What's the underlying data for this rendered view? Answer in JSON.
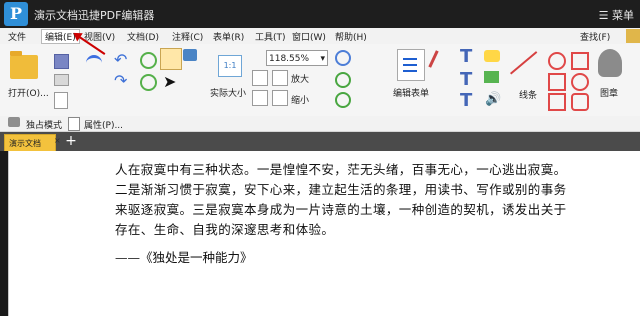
{
  "window": {
    "title": "演示文档迅捷PDF编辑器",
    "logo": "P",
    "menu_button": "☰ 菜单"
  },
  "menubar": {
    "items": [
      {
        "label": "文件"
      },
      {
        "label": "编辑(E)"
      },
      {
        "label": "视图(V)"
      },
      {
        "label": "文档(D)"
      },
      {
        "label": "注释(C)"
      },
      {
        "label": "表单(R)"
      },
      {
        "label": "工具(T)"
      },
      {
        "label": "窗口(W)"
      },
      {
        "label": "帮助(H)"
      }
    ],
    "find": "查找(F)"
  },
  "toolbar": {
    "open": "打开(O)...",
    "actual_size": "实际大小",
    "zoom_value": "118.55%",
    "zoom_in": "放大",
    "zoom_out": "缩小",
    "form_edit": "编辑表单",
    "line": "线条",
    "stamp": "图章"
  },
  "secondary_toolbar": {
    "exclusive_mode": "独占模式",
    "properties": "属性(P)..."
  },
  "tabs": {
    "active": "演示文档",
    "close": "×",
    "add": "+"
  },
  "document": {
    "paragraph_lines": [
      "人在寂寞中有三种状态。一是惶惶不安，茫无头绪，百事无心，一心逃出寂寞。",
      "二是渐渐习惯于寂寞，安下心来，建立起生活的条理，用读书、写作或别的事务",
      "来驱逐寂寞。三是寂寞本身成为一片诗意的土壤，一种创造的契机，诱发出关于",
      "存在、生命、自我的深邃思考和体验。"
    ],
    "quote": "——《独处是一种能力》"
  }
}
